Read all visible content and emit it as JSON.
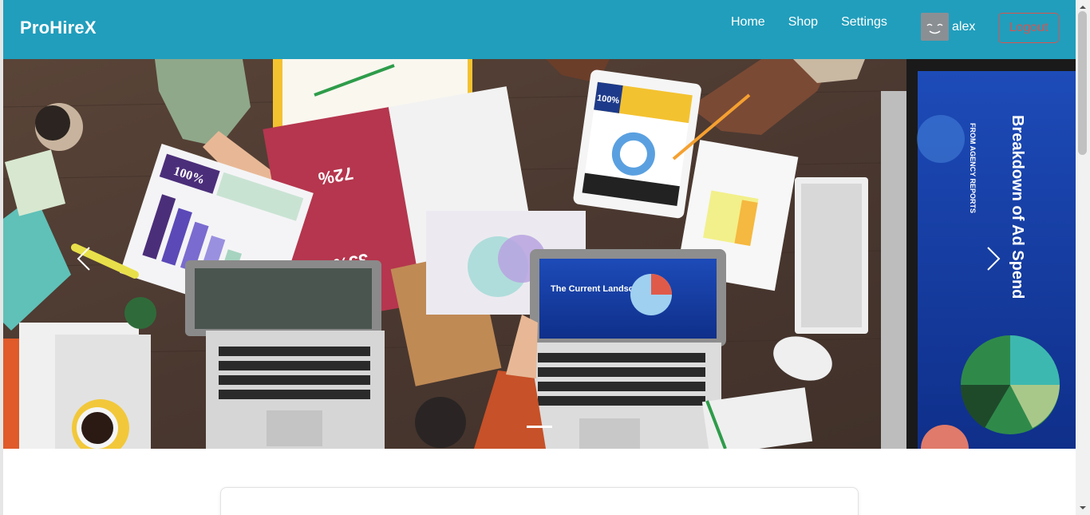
{
  "navbar": {
    "brand": "ProHireX",
    "links": [
      "Home",
      "Shop",
      "Settings"
    ],
    "username": "alex",
    "logout_label": "Logout",
    "background_color": "#219ebc",
    "logout_color": "#d9534f"
  },
  "hero": {
    "image_text": {
      "monitor_title": "Breakdown of Ad Spend",
      "monitor_subtitle": "FROM AGENCY REPORTS",
      "laptop_title": "The Current Landscape",
      "booklet_big": "72%",
      "booklet_small": "35%",
      "chart_sheet": "100%",
      "tablet": "100%"
    },
    "slide_count": 1,
    "active_slide": 1
  }
}
